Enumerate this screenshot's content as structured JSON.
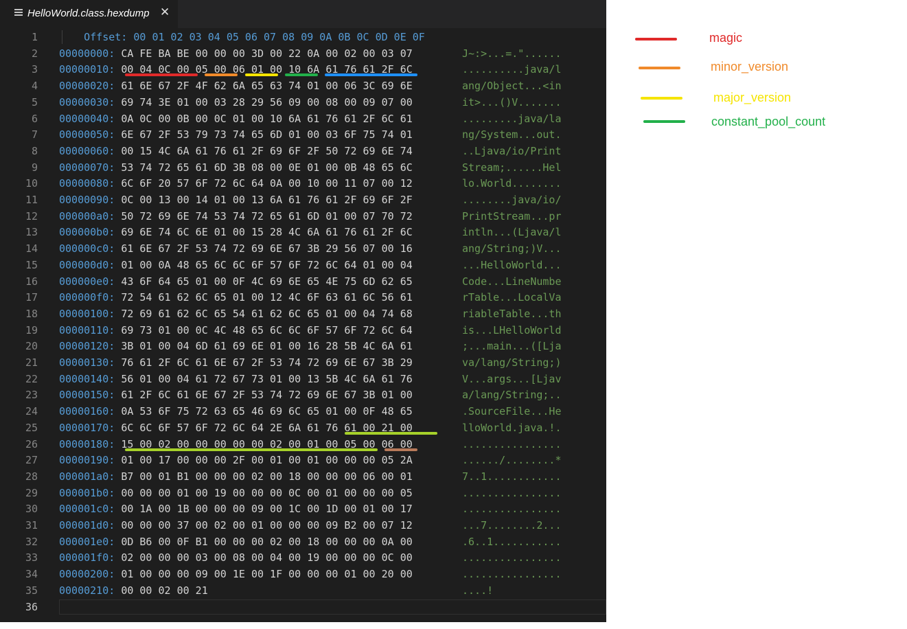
{
  "tab": {
    "title": "HelloWorld.class.hexdump",
    "icon": "file-lines-icon",
    "close_icon": "close-icon"
  },
  "header": {
    "line_number": "1",
    "offset_label": "Offset:",
    "columns": [
      "00",
      "01",
      "02",
      "03",
      "04",
      "05",
      "06",
      "07",
      "08",
      "09",
      "0A",
      "0B",
      "0C",
      "0D",
      "0E",
      "0F"
    ]
  },
  "rows": [
    {
      "n": "2",
      "offset": "00000000:",
      "hex": "CA FE BA BE 00 00 00 3D 00 22 0A 00 02 00 03 07",
      "ascii": "J~:>...=.\"......"
    },
    {
      "n": "3",
      "offset": "00000010:",
      "hex": "00 04 0C 00 05 00 06 01 00 10 6A 61 76 61 2F 6C",
      "ascii": "..........java/l"
    },
    {
      "n": "4",
      "offset": "00000020:",
      "hex": "61 6E 67 2F 4F 62 6A 65 63 74 01 00 06 3C 69 6E",
      "ascii": "ang/Object...<in"
    },
    {
      "n": "5",
      "offset": "00000030:",
      "hex": "69 74 3E 01 00 03 28 29 56 09 00 08 00 09 07 00",
      "ascii": "it>...()V......."
    },
    {
      "n": "6",
      "offset": "00000040:",
      "hex": "0A 0C 00 0B 00 0C 01 00 10 6A 61 76 61 2F 6C 61",
      "ascii": ".........java/la"
    },
    {
      "n": "7",
      "offset": "00000050:",
      "hex": "6E 67 2F 53 79 73 74 65 6D 01 00 03 6F 75 74 01",
      "ascii": "ng/System...out."
    },
    {
      "n": "8",
      "offset": "00000060:",
      "hex": "00 15 4C 6A 61 76 61 2F 69 6F 2F 50 72 69 6E 74",
      "ascii": "..Ljava/io/Print"
    },
    {
      "n": "9",
      "offset": "00000070:",
      "hex": "53 74 72 65 61 6D 3B 08 00 0E 01 00 0B 48 65 6C",
      "ascii": "Stream;......Hel"
    },
    {
      "n": "10",
      "offset": "00000080:",
      "hex": "6C 6F 20 57 6F 72 6C 64 0A 00 10 00 11 07 00 12",
      "ascii": "lo.World........"
    },
    {
      "n": "11",
      "offset": "00000090:",
      "hex": "0C 00 13 00 14 01 00 13 6A 61 76 61 2F 69 6F 2F",
      "ascii": "........java/io/"
    },
    {
      "n": "12",
      "offset": "000000a0:",
      "hex": "50 72 69 6E 74 53 74 72 65 61 6D 01 00 07 70 72",
      "ascii": "PrintStream...pr"
    },
    {
      "n": "13",
      "offset": "000000b0:",
      "hex": "69 6E 74 6C 6E 01 00 15 28 4C 6A 61 76 61 2F 6C",
      "ascii": "intln...(Ljava/l"
    },
    {
      "n": "14",
      "offset": "000000c0:",
      "hex": "61 6E 67 2F 53 74 72 69 6E 67 3B 29 56 07 00 16",
      "ascii": "ang/String;)V..."
    },
    {
      "n": "15",
      "offset": "000000d0:",
      "hex": "01 00 0A 48 65 6C 6C 6F 57 6F 72 6C 64 01 00 04",
      "ascii": "...HelloWorld..."
    },
    {
      "n": "16",
      "offset": "000000e0:",
      "hex": "43 6F 64 65 01 00 0F 4C 69 6E 65 4E 75 6D 62 65",
      "ascii": "Code...LineNumbe"
    },
    {
      "n": "17",
      "offset": "000000f0:",
      "hex": "72 54 61 62 6C 65 01 00 12 4C 6F 63 61 6C 56 61",
      "ascii": "rTable...LocalVa"
    },
    {
      "n": "18",
      "offset": "00000100:",
      "hex": "72 69 61 62 6C 65 54 61 62 6C 65 01 00 04 74 68",
      "ascii": "riableTable...th"
    },
    {
      "n": "19",
      "offset": "00000110:",
      "hex": "69 73 01 00 0C 4C 48 65 6C 6C 6F 57 6F 72 6C 64",
      "ascii": "is...LHelloWorld"
    },
    {
      "n": "20",
      "offset": "00000120:",
      "hex": "3B 01 00 04 6D 61 69 6E 01 00 16 28 5B 4C 6A 61",
      "ascii": ";...main...([Lja"
    },
    {
      "n": "21",
      "offset": "00000130:",
      "hex": "76 61 2F 6C 61 6E 67 2F 53 74 72 69 6E 67 3B 29",
      "ascii": "va/lang/String;)"
    },
    {
      "n": "22",
      "offset": "00000140:",
      "hex": "56 01 00 04 61 72 67 73 01 00 13 5B 4C 6A 61 76",
      "ascii": "V...args...[Ljav"
    },
    {
      "n": "23",
      "offset": "00000150:",
      "hex": "61 2F 6C 61 6E 67 2F 53 74 72 69 6E 67 3B 01 00",
      "ascii": "a/lang/String;.."
    },
    {
      "n": "24",
      "offset": "00000160:",
      "hex": "0A 53 6F 75 72 63 65 46 69 6C 65 01 00 0F 48 65",
      "ascii": ".SourceFile...He"
    },
    {
      "n": "25",
      "offset": "00000170:",
      "hex": "6C 6C 6F 57 6F 72 6C 64 2E 6A 61 76 61 00 21 00",
      "ascii": "lloWorld.java.!."
    },
    {
      "n": "26",
      "offset": "00000180:",
      "hex": "15 00 02 00 00 00 00 00 02 00 01 00 05 00 06 00",
      "ascii": "................"
    },
    {
      "n": "27",
      "offset": "00000190:",
      "hex": "01 00 17 00 00 00 2F 00 01 00 01 00 00 00 05 2A",
      "ascii": "....../........*"
    },
    {
      "n": "28",
      "offset": "000001a0:",
      "hex": "B7 00 01 B1 00 00 00 02 00 18 00 00 00 06 00 01",
      "ascii": "7..1............"
    },
    {
      "n": "29",
      "offset": "000001b0:",
      "hex": "00 00 00 01 00 19 00 00 00 0C 00 01 00 00 00 05",
      "ascii": "................"
    },
    {
      "n": "30",
      "offset": "000001c0:",
      "hex": "00 1A 00 1B 00 00 00 09 00 1C 00 1D 00 01 00 17",
      "ascii": "................"
    },
    {
      "n": "31",
      "offset": "000001d0:",
      "hex": "00 00 00 37 00 02 00 01 00 00 00 09 B2 00 07 12",
      "ascii": "...7........2..."
    },
    {
      "n": "32",
      "offset": "000001e0:",
      "hex": "0D B6 00 0F B1 00 00 00 02 00 18 00 00 00 0A 00",
      "ascii": ".6..1..........."
    },
    {
      "n": "33",
      "offset": "000001f0:",
      "hex": "02 00 00 00 03 00 08 00 04 00 19 00 00 00 0C 00",
      "ascii": "................"
    },
    {
      "n": "34",
      "offset": "00000200:",
      "hex": "01 00 00 00 09 00 1E 00 1F 00 00 00 01 00 20 00",
      "ascii": "................"
    },
    {
      "n": "35",
      "offset": "00000210:",
      "hex": "00 00 02 00 21",
      "ascii": "....!"
    }
  ],
  "last_line": "36",
  "legend": [
    {
      "label": "magic",
      "color": "#e02a2a"
    },
    {
      "label": "minor_version",
      "color": "#f08a2a"
    },
    {
      "label": "major_version",
      "color": "#f5e400"
    },
    {
      "label": "constant_pool_count",
      "color": "#22b04a"
    }
  ],
  "highlight_colors": {
    "magic": "#e02a2a",
    "minor_version": "#f08a2a",
    "major_version": "#f5e400",
    "constant_pool_count": "#22b04a",
    "constant_pool_item": "#1e90ff",
    "source_file_entry": "#a6d12a",
    "access_flags": "#b87a5a"
  }
}
